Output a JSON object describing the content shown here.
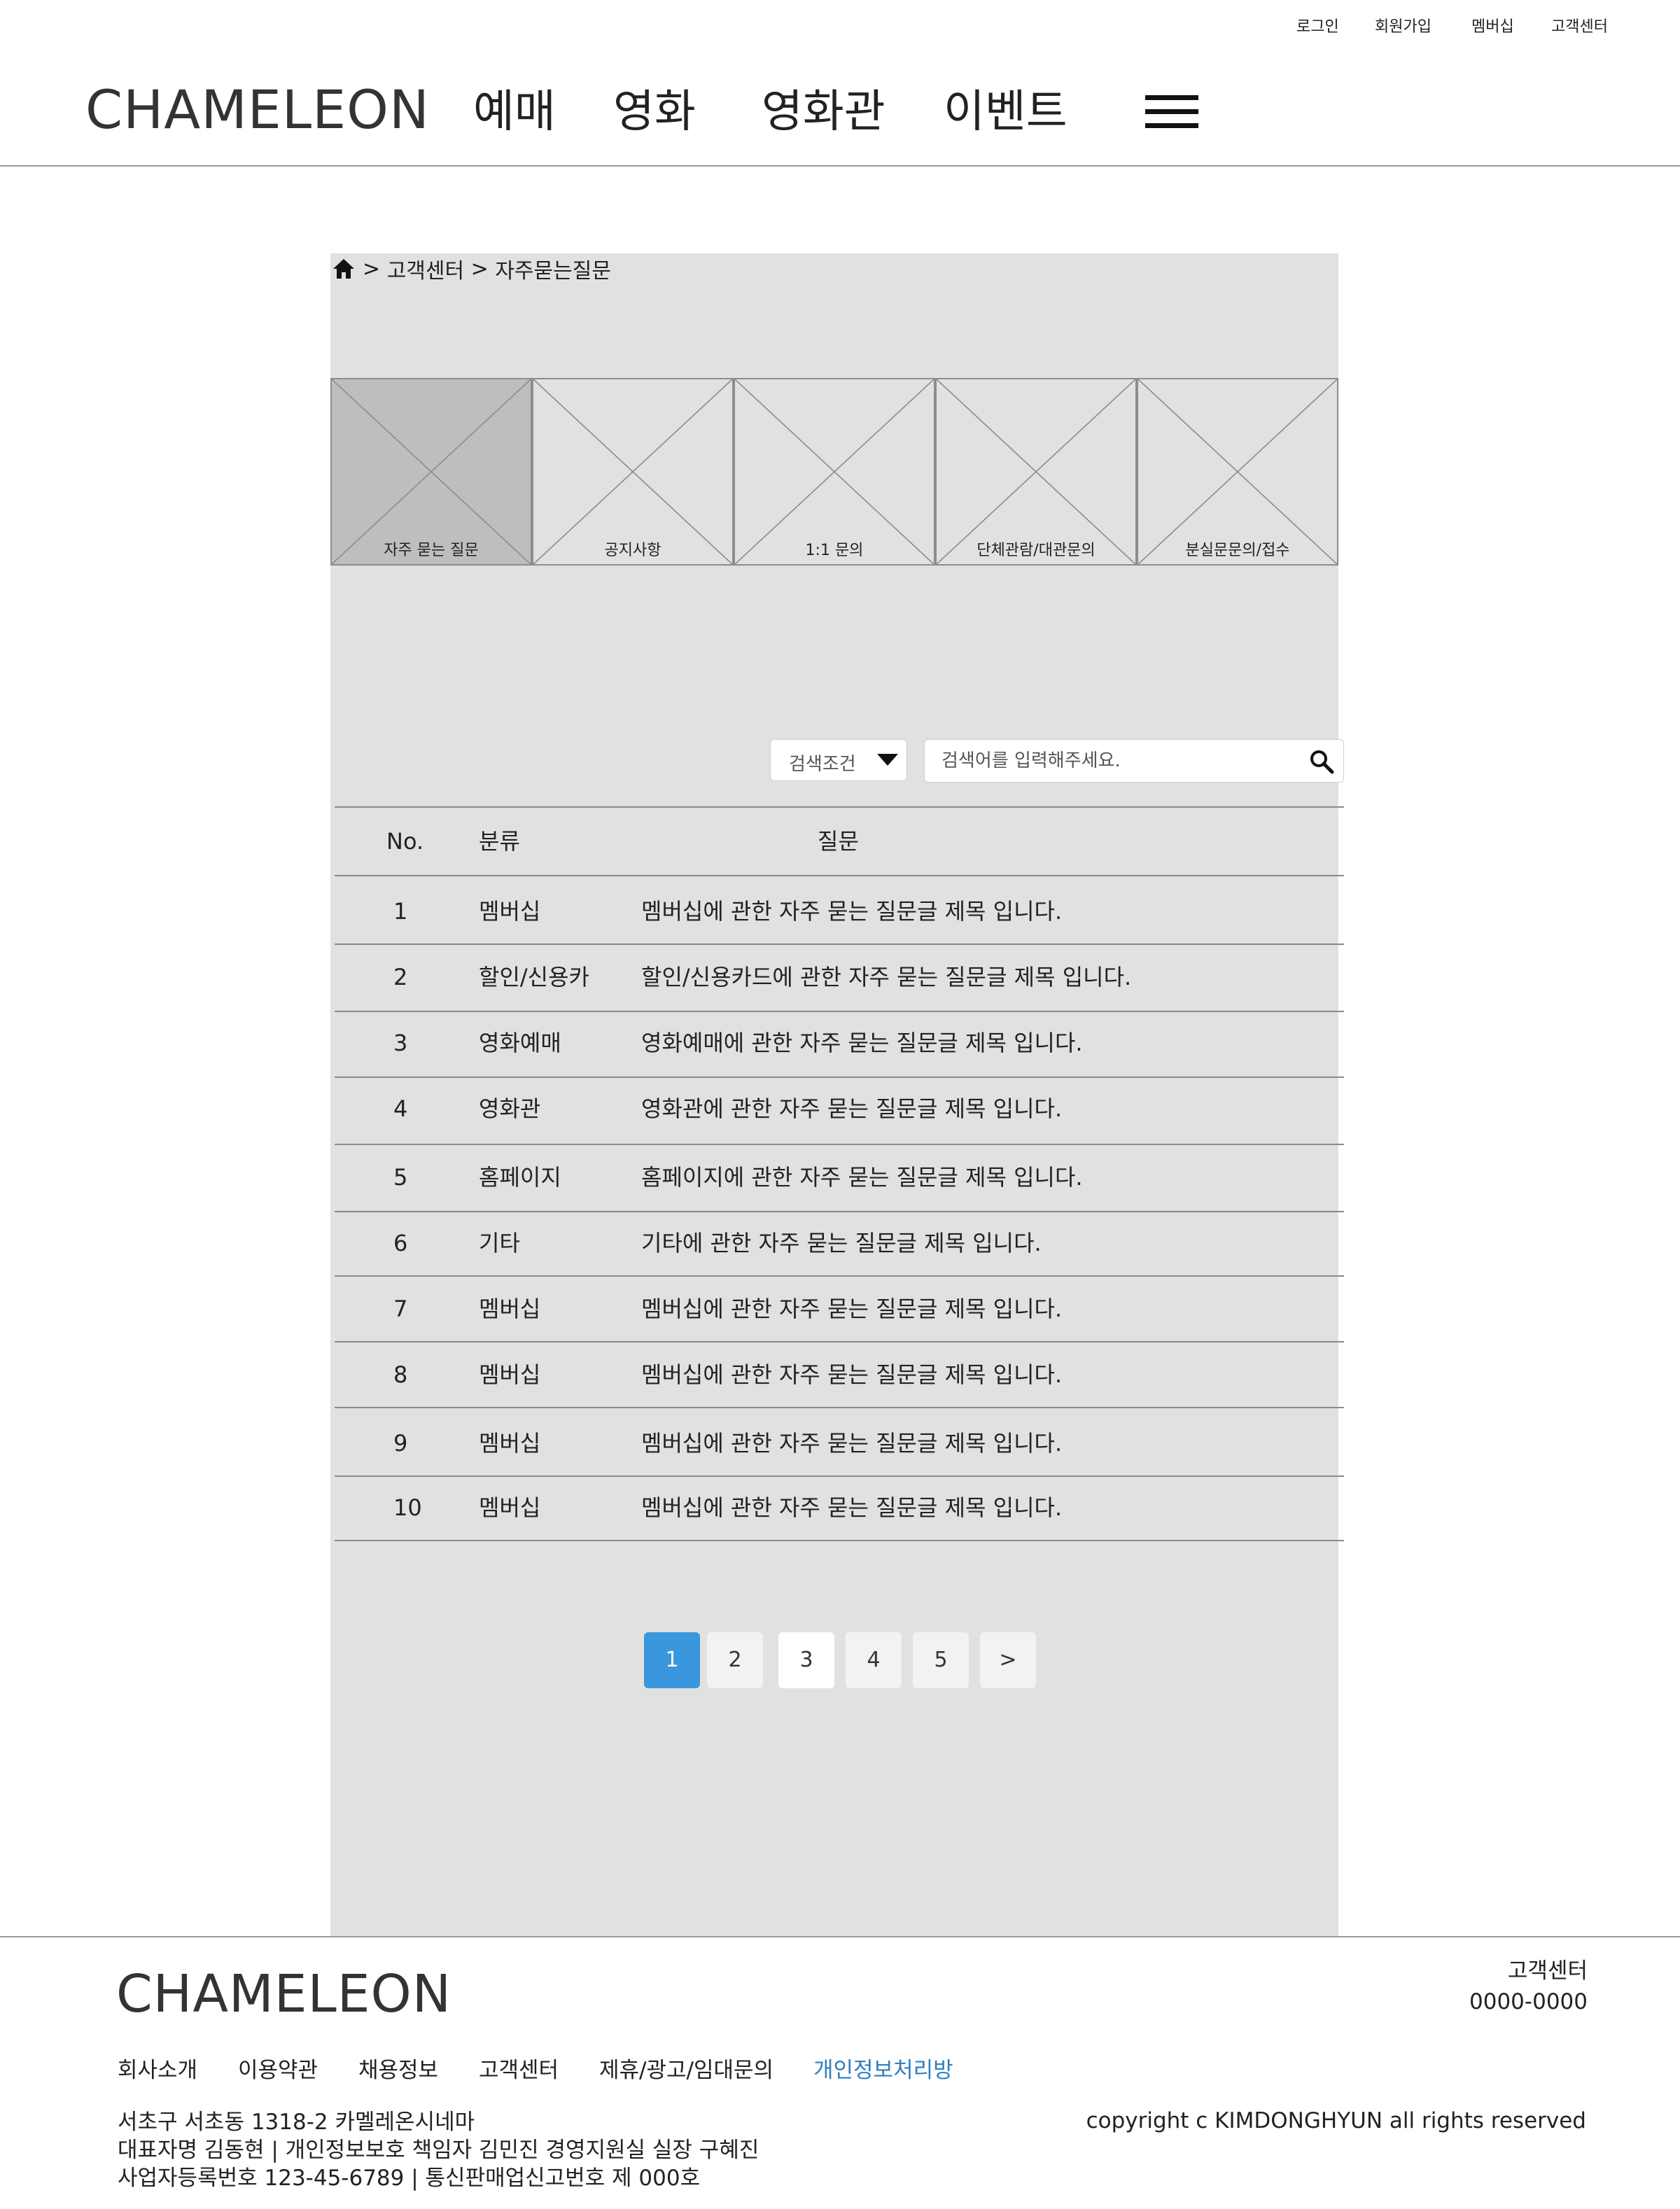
{
  "top_links": [
    "로그인",
    "회원가입",
    "멤버십",
    "고객센터"
  ],
  "header": {
    "logo": "CHAMELEON",
    "nav": [
      "예매",
      "영화",
      "영화관",
      "이벤트"
    ]
  },
  "breadcrumb": {
    "separator": ">",
    "items": [
      "고객센터",
      "자주묻는질문"
    ]
  },
  "category_tiles": {
    "active_index": 0,
    "items": [
      "자주 묻는 질문",
      "공지사항",
      "1:1 문의",
      "단체관람/대관문의",
      "분실문문의/접수"
    ]
  },
  "search": {
    "condition_label": "검색조건",
    "placeholder": "검색어를 입력해주세요.",
    "value": ""
  },
  "table": {
    "headers": {
      "no": "No.",
      "category": "분류",
      "question": "질문"
    },
    "rows": [
      {
        "no": "1",
        "category": "멤버십",
        "question": "멤버십에 관한 자주 묻는 질문글 제목 입니다."
      },
      {
        "no": "2",
        "category": "할인/신용카",
        "question": "할인/신용카드에 관한 자주 묻는 질문글 제목 입니다."
      },
      {
        "no": "3",
        "category": "영화예매",
        "question": "영화예매에 관한 자주 묻는 질문글 제목 입니다."
      },
      {
        "no": "4",
        "category": "영화관",
        "question": "영화관에 관한 자주 묻는 질문글 제목 입니다."
      },
      {
        "no": "5",
        "category": "홈페이지",
        "question": "홈페이지에 관한 자주 묻는 질문글 제목 입니다."
      },
      {
        "no": "6",
        "category": "기타",
        "question": "기타에 관한 자주 묻는 질문글 제목 입니다."
      },
      {
        "no": "7",
        "category": "멤버십",
        "question": "멤버십에 관한 자주 묻는 질문글 제목 입니다."
      },
      {
        "no": "8",
        "category": "멤버십",
        "question": "멤버십에 관한 자주 묻는 질문글 제목 입니다."
      },
      {
        "no": "9",
        "category": "멤버십",
        "question": "멤버십에 관한 자주 묻는 질문글 제목 입니다."
      },
      {
        "no": "10",
        "category": "멤버십",
        "question": "멤버십에 관한 자주 묻는 질문글 제목 입니다."
      }
    ]
  },
  "pagination": {
    "current": "1",
    "pages": [
      "1",
      "2",
      "3",
      "4",
      "5"
    ],
    "next": ">"
  },
  "footer": {
    "logo": "CHAMELEON",
    "cs_label": "고객센터",
    "cs_phone": "0000-0000",
    "links": [
      "회사소개",
      "이용약관",
      "채용정보",
      "고객센터",
      "제휴/광고/임대문의",
      "개인정보처리방"
    ],
    "address_lines": [
      "서초구 서초동 1318-2 카멜레온시네마",
      "대표자명 김동현 | 개인정보보호 책임자 김민진 경영지원실 실장 구혜진",
      "사업자등록번호 123-45-6789 | 통신판매업신고번호 제 000호"
    ],
    "copyright": "copyright c KIMDONGHYUN all rights reserved"
  },
  "colors": {
    "accent": "#3a96dd",
    "panel_bg": "#e1e1e1",
    "active_tile": "#bebebe",
    "footer_link_highlight": "#2e7ebf"
  }
}
